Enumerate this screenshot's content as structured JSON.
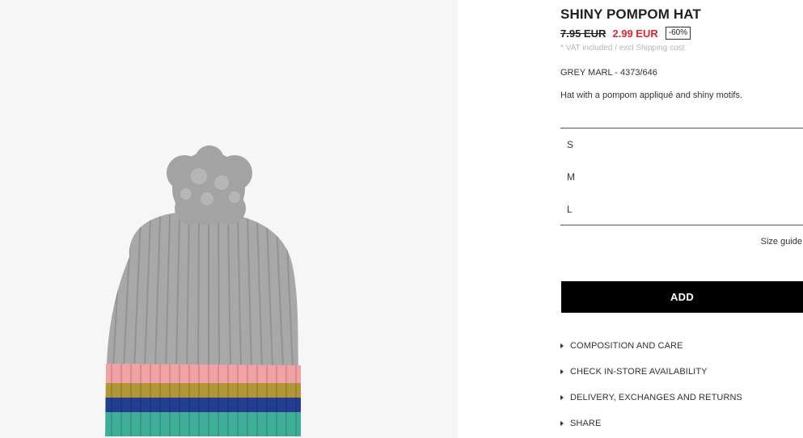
{
  "product": {
    "title": "SHINY POMPOM HAT",
    "old_price": "7.95 EUR",
    "new_price": "2.99 EUR",
    "discount": "-60%",
    "vat_note": "* VAT included / excl Shipping cost",
    "color_ref": "GREY MARL - 4373/646",
    "description": "Hat with a pompom appliqué and shiny motifs."
  },
  "sizes": [
    "S",
    "M",
    "L"
  ],
  "size_guide_label": "Size guide",
  "add_button_label": "ADD",
  "links": [
    "COMPOSITION AND CARE",
    "CHECK IN-STORE AVAILABILITY",
    "DELIVERY, EXCHANGES AND RETURNS",
    "SHARE"
  ],
  "colors": {
    "price_red": "#e0262b",
    "hat_grey": "#a7a7a7",
    "stripe_pink": "#f2a2a4",
    "stripe_gold": "#b09636",
    "stripe_blue": "#233d90",
    "stripe_teal": "#3fae98"
  }
}
